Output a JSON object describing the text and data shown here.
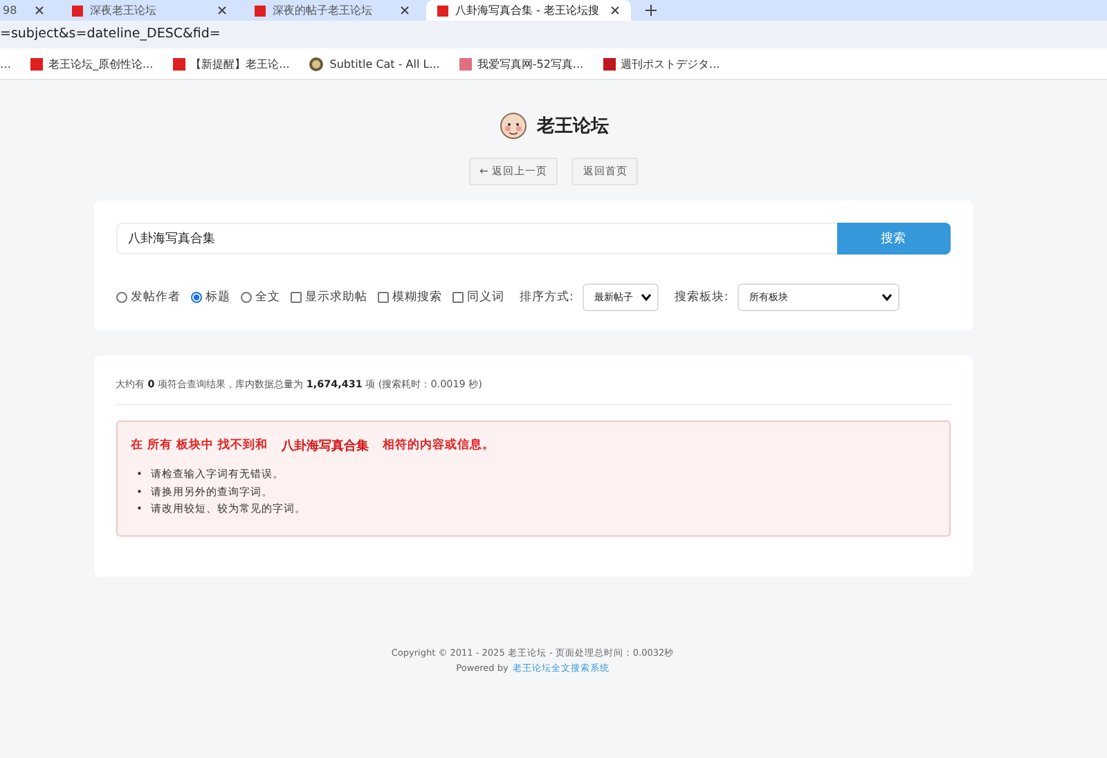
{
  "browser": {
    "tabs": [
      {
        "title": "98",
        "selected": false
      },
      {
        "title": "深夜老王论坛",
        "selected": false
      },
      {
        "title": "深夜的帖子老王论坛",
        "selected": false
      },
      {
        "title": "八卦海写真合集 - 老王论坛搜",
        "selected": true
      }
    ],
    "address": "=subject&s=dateline_DESC&fid=",
    "bookmarks": [
      {
        "label": "…",
        "kind": "more"
      },
      {
        "label": "老王论坛_原创性论...",
        "kind": "mx"
      },
      {
        "label": "【新提醒】老王论...",
        "kind": "mx"
      },
      {
        "label": "Subtitle Cat - All L...",
        "kind": "cat"
      },
      {
        "label": "我爱写真网-52写真...",
        "kind": "photo"
      },
      {
        "label": "週刊ポストデジタ...",
        "kind": "v2"
      }
    ]
  },
  "site": {
    "title": "老王论坛",
    "nav": [
      "← 返回上一页",
      "返回首页"
    ]
  },
  "search": {
    "value": "八卦海写真合集",
    "button": "搜索",
    "scopes": [
      {
        "label": "发帖作者",
        "selected": false
      },
      {
        "label": "标题",
        "selected": true
      },
      {
        "label": "全文",
        "selected": false
      }
    ],
    "options": [
      {
        "label": "显示求助帖",
        "checked": false
      },
      {
        "label": "模糊搜索",
        "checked": false
      },
      {
        "label": "同义词",
        "checked": false
      }
    ],
    "sort_label": "排序方式:",
    "sort_value": "最新帖子",
    "board_label": "搜索板块:",
    "board_value": "所有板块"
  },
  "results": {
    "summary": "大约有 **0** 项符合查询结果，库内数据总量为 **1,674,431** 项 (搜索耗时：0.0019 秒)",
    "notice": {
      "prefix": "在 所有 板块中 找不到和",
      "keyword": "八卦海写真合集",
      "suffix": "相符的内容或信息。",
      "marker": "•",
      "tips": [
        "请检查输入字词有无错误。",
        "请换用另外的查询字词。",
        "请改用较短、较为常见的字词。"
      ]
    }
  },
  "footer": {
    "copyright": "Copyright © 2011 - 2025 老王论坛 - 页面处理总时间：0.0032秒",
    "powered": "Powered by",
    "link": "老王论坛全文搜索系统"
  }
}
